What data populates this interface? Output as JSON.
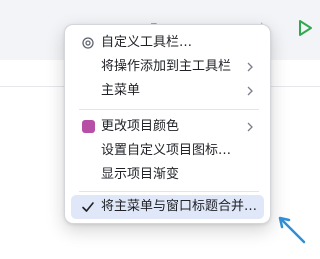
{
  "menu": {
    "items": [
      {
        "label": "自定义工具栏…",
        "icon": "gear-icon",
        "submenu": false
      },
      {
        "label": "将操作添加到主工具栏",
        "submenu": true
      },
      {
        "label": "主菜单",
        "submenu": true
      },
      {
        "label": "更改项目颜色",
        "icon": "color-swatch-icon",
        "submenu": true
      },
      {
        "label": "设置自定义项目图标…",
        "submenu": false
      },
      {
        "label": "显示项目渐变",
        "submenu": false
      },
      {
        "label": "将主菜单与窗口标题合并…",
        "icon": "checkmark-icon",
        "submenu": false,
        "checked": true
      }
    ]
  },
  "colors": {
    "swatch": "#b84fa6",
    "selection": "#dfe7f8",
    "pointer_arrow": "#2e8fd6",
    "run_icon": "#2fa84f"
  }
}
